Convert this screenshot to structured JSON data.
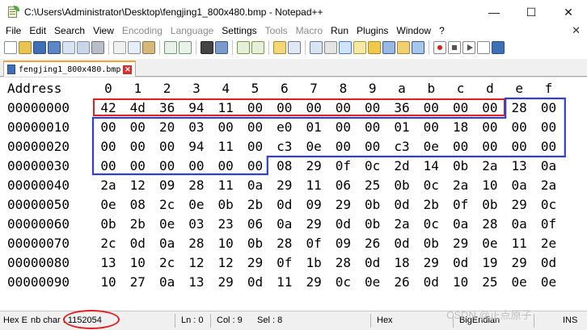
{
  "window": {
    "title": "C:\\Users\\Administrator\\Desktop\\fengjing1_800x480.bmp - Notepad++",
    "minimize": "—",
    "maximize": "☐",
    "close": "✕"
  },
  "menu": {
    "items": [
      {
        "label": "File",
        "enabled": true
      },
      {
        "label": "Edit",
        "enabled": true
      },
      {
        "label": "Search",
        "enabled": true
      },
      {
        "label": "View",
        "enabled": true
      },
      {
        "label": "Encoding",
        "enabled": false
      },
      {
        "label": "Language",
        "enabled": false
      },
      {
        "label": "Settings",
        "enabled": true
      },
      {
        "label": "Tools",
        "enabled": false
      },
      {
        "label": "Macro",
        "enabled": false
      },
      {
        "label": "Run",
        "enabled": true
      },
      {
        "label": "Plugins",
        "enabled": true
      },
      {
        "label": "Window",
        "enabled": true
      },
      {
        "label": "?",
        "enabled": true
      }
    ],
    "close_glyph": "✕"
  },
  "toolbar": {
    "icons": [
      "new-file-icon",
      "open-file-icon",
      "save-icon",
      "save-all-icon",
      "close-icon",
      "close-all-icon",
      "print-icon",
      "cut-icon",
      "copy-icon",
      "paste-icon",
      "undo-icon",
      "redo-icon",
      "find-icon",
      "replace-icon",
      "zoom-in-icon",
      "zoom-out-icon",
      "sync-scroll-icon",
      "word-wrap-icon",
      "show-all-chars-icon",
      "indent-guide-icon",
      "hex-editor-icon",
      "user-language-icon",
      "document-map-icon",
      "function-list-icon",
      "folder-workspace-icon",
      "monitoring-icon",
      "record-macro-icon",
      "stop-record-icon",
      "playback-macro-icon",
      "run-macro-multiple-icon",
      "save-macro-icon"
    ]
  },
  "tab": {
    "label": "fengjing1_800x480.bmp",
    "close_glyph": "✕"
  },
  "hex": {
    "header_label": "Address",
    "columns": [
      "0",
      "1",
      "2",
      "3",
      "4",
      "5",
      "6",
      "7",
      "8",
      "9",
      "a",
      "b",
      "c",
      "d",
      "e",
      "f"
    ],
    "rows": [
      {
        "address": "00000000",
        "bytes": [
          "42",
          "4d",
          "36",
          "94",
          "11",
          "00",
          "00",
          "00",
          "00",
          "00",
          "36",
          "00",
          "00",
          "00",
          "28",
          "00"
        ]
      },
      {
        "address": "00000010",
        "bytes": [
          "00",
          "00",
          "20",
          "03",
          "00",
          "00",
          "e0",
          "01",
          "00",
          "00",
          "01",
          "00",
          "18",
          "00",
          "00",
          "00"
        ]
      },
      {
        "address": "00000020",
        "bytes": [
          "00",
          "00",
          "00",
          "94",
          "11",
          "00",
          "c3",
          "0e",
          "00",
          "00",
          "c3",
          "0e",
          "00",
          "00",
          "00",
          "00"
        ]
      },
      {
        "address": "00000030",
        "bytes": [
          "00",
          "00",
          "00",
          "00",
          "00",
          "00",
          "08",
          "29",
          "0f",
          "0c",
          "2d",
          "14",
          "0b",
          "2a",
          "13",
          "0a"
        ]
      },
      {
        "address": "00000040",
        "bytes": [
          "2a",
          "12",
          "09",
          "28",
          "11",
          "0a",
          "29",
          "11",
          "06",
          "25",
          "0b",
          "0c",
          "2a",
          "10",
          "0a",
          "2a"
        ]
      },
      {
        "address": "00000050",
        "bytes": [
          "0e",
          "08",
          "2c",
          "0e",
          "0b",
          "2b",
          "0d",
          "09",
          "29",
          "0b",
          "0d",
          "2b",
          "0f",
          "0b",
          "29",
          "0c"
        ]
      },
      {
        "address": "00000060",
        "bytes": [
          "0b",
          "2b",
          "0e",
          "03",
          "23",
          "06",
          "0a",
          "29",
          "0d",
          "0b",
          "2a",
          "0c",
          "0a",
          "28",
          "0a",
          "0f"
        ]
      },
      {
        "address": "00000070",
        "bytes": [
          "2c",
          "0d",
          "0a",
          "28",
          "10",
          "0b",
          "28",
          "0f",
          "09",
          "26",
          "0d",
          "0b",
          "29",
          "0e",
          "11",
          "2e"
        ]
      },
      {
        "address": "00000080",
        "bytes": [
          "13",
          "10",
          "2c",
          "12",
          "12",
          "29",
          "0f",
          "1b",
          "28",
          "0d",
          "18",
          "29",
          "0d",
          "19",
          "29",
          "0d"
        ]
      },
      {
        "address": "00000090",
        "bytes": [
          "10",
          "27",
          "0a",
          "13",
          "29",
          "0d",
          "11",
          "29",
          "0c",
          "0e",
          "26",
          "0d",
          "10",
          "25",
          "0e",
          "0e"
        ]
      }
    ],
    "highlight_colors": {
      "red": "#e02020",
      "blue": "#2f3fd0"
    }
  },
  "status": {
    "type": "Hex E",
    "nb_char": "nb char : 1152054",
    "ln": "Ln : 0",
    "col": "Col : 9",
    "sel": "Sel : 8",
    "mode": "Hex",
    "endian": "BigEndian",
    "ins": "INS"
  },
  "watermark": "CSDN @正点原子"
}
